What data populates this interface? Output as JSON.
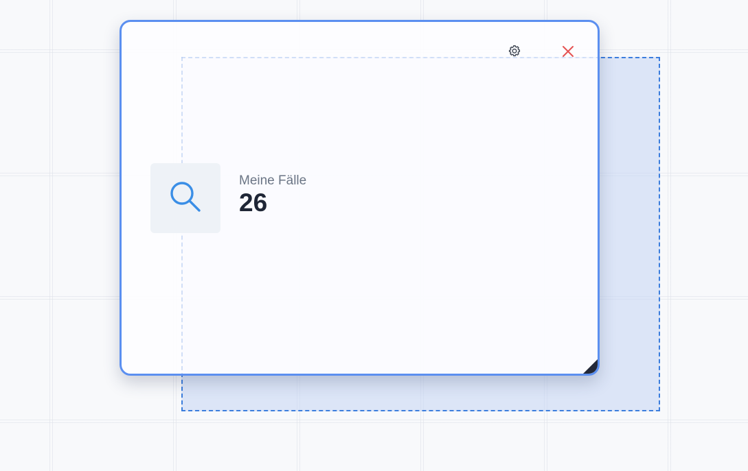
{
  "widget": {
    "label": "Meine Fälle",
    "value": "26",
    "icon": "search-icon",
    "settings_icon": "gear-icon",
    "close_icon": "close-icon"
  },
  "colors": {
    "accent": "#5b8ff0",
    "drop_border": "#3b7ddd",
    "icon": "#3a8ee6",
    "close": "#e55353"
  }
}
